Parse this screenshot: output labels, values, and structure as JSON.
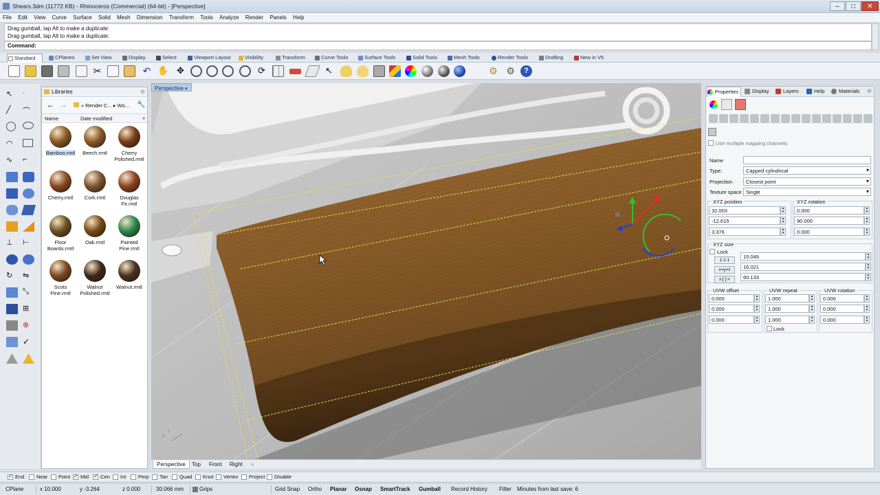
{
  "window": {
    "title": "Shears.3dm (11772 KB) - Rhinoceros (Commercial) (64-bit) - [Perspective]",
    "minimize": "–",
    "maximize": "□",
    "close": "✕"
  },
  "menu": [
    "File",
    "Edit",
    "View",
    "Curve",
    "Surface",
    "Solid",
    "Mesh",
    "Dimension",
    "Transform",
    "Tools",
    "Analyze",
    "Render",
    "Panels",
    "Help"
  ],
  "command_history": [
    "Drag gumball, tap Alt to make a duplicate:",
    "Drag gumball, tap Alt to make a duplicate:"
  ],
  "command_prompt": "Command:",
  "toolbar_tabs": [
    "Standard",
    "CPlanes",
    "Set View",
    "Display",
    "Select",
    "Viewport Layout",
    "Visibility",
    "Transform",
    "Curve Tools",
    "Surface Tools",
    "Solid Tools",
    "Mesh Tools",
    "Render Tools",
    "Drafting",
    "New in V5"
  ],
  "toolbar_icons": [
    "new-file-icon",
    "open-file-icon",
    "save-icon",
    "print-icon",
    "import-icon",
    "cut-icon",
    "copy-icon",
    "paste-icon",
    "undo-icon",
    "pan-hand-icon",
    "move-view-icon",
    "zoom-window-icon",
    "zoom-dynamic-icon",
    "zoom-extents-icon",
    "zoom-selected-icon",
    "rotate-view-icon",
    "four-viewports-icon",
    "cplane-icon",
    "viewport-icon",
    "select-icon",
    "light-bulb-icon",
    "lock-icon",
    "layer-icon",
    "color-wheel-icon",
    "render-sphere-icon",
    "shaded-sphere-icon",
    "blue-sphere-icon",
    "settings-gear-icon",
    "options-icon",
    "help-icon"
  ],
  "libraries": {
    "title": "Libraries",
    "path": "« Render C... ▸ Wo...",
    "col_name": "Name",
    "col_date": "Date modified",
    "col_more": "»",
    "materials": [
      {
        "name": "Bamboo.rmtl",
        "color": "#8a5a26",
        "selected": true
      },
      {
        "name": "Beech.rmtl",
        "color": "#8d5a2c"
      },
      {
        "name": "Cherry Polished.rmtl",
        "color": "#7a3c1c"
      },
      {
        "name": "Cherry.rmtl",
        "color": "#8a4a22"
      },
      {
        "name": "Cork.rmtl",
        "color": "#7c5630"
      },
      {
        "name": "Douglas Fir.rmtl",
        "color": "#8a4422"
      },
      {
        "name": "Floor Boards.rmtl",
        "color": "#6e5024"
      },
      {
        "name": "Oak.rmtl",
        "color": "#7a4a18"
      },
      {
        "name": "Painted Pine.rmtl",
        "color": "#2c8a4a"
      },
      {
        "name": "Scots Pine.rmtl",
        "color": "#7c4a24"
      },
      {
        "name": "Walnut Polished.rmtl",
        "color": "#3f2a1c"
      },
      {
        "name": "Walnut.rmtl",
        "color": "#4a3222"
      }
    ]
  },
  "viewport": {
    "label": "Perspective",
    "tabs": [
      "Perspective",
      "Top",
      "Front",
      "Right"
    ],
    "add_tab": "+"
  },
  "properties": {
    "tabs": [
      "Properties",
      "Display",
      "Layers",
      "Help",
      "Materials"
    ],
    "use_multiple_mapping": "Use multiple mapping channels",
    "name_label": "Name",
    "name_value": "",
    "type_label": "Type:",
    "type_value": "Capped cylindrical",
    "projection_label": "Projection",
    "projection_value": "Closest point",
    "texture_space_label": "Texture space",
    "texture_space_value": "Single",
    "xyz_position_label": "XYZ position",
    "xyz_position": [
      "32.003",
      "-12.615",
      "3.376"
    ],
    "xyz_rotation_label": "XYZ rotation",
    "xyz_rotation": [
      "0.000",
      "90.000",
      "0.000"
    ],
    "xyz_size_label": "XYZ size",
    "lock_label": "Lock",
    "size_buttons": [
      "1:1:1",
      "x=y=z",
      "x:[ ]:<"
    ],
    "xyz_size": [
      "15.049",
      "16.021",
      "60.133"
    ],
    "uvw_offset_label": "UVW offset",
    "uvw_offset": [
      "0.000",
      "0.000",
      "0.000"
    ],
    "uvw_repeat_label": "UVW repeat",
    "uvw_repeat": [
      "1.000",
      "1.000",
      "1.000"
    ],
    "uvw_repeat_lock": "Lock",
    "uvw_rotation_label": "UVW rotation",
    "uvw_rotation": [
      "0.000",
      "0.000",
      "0.000"
    ]
  },
  "osnaps": [
    {
      "label": "End",
      "checked": true
    },
    {
      "label": "Near",
      "checked": false
    },
    {
      "label": "Point",
      "checked": false
    },
    {
      "label": "Mid",
      "checked": true
    },
    {
      "label": "Cen",
      "checked": true
    },
    {
      "label": "Int",
      "checked": false
    },
    {
      "label": "Perp",
      "checked": false
    },
    {
      "label": "Tan",
      "checked": false
    },
    {
      "label": "Quad",
      "checked": false
    },
    {
      "label": "Knot",
      "checked": false
    },
    {
      "label": "Vertex",
      "checked": false
    },
    {
      "label": "Project",
      "checked": false
    },
    {
      "label": "Disable",
      "checked": false
    }
  ],
  "status": {
    "cplane": "CPlane",
    "x": "x 10.000",
    "y": "y -3.264",
    "z": "z 0.000",
    "distance": "30.066 mm",
    "layer": "Grips",
    "grid_snap": "Grid Snap",
    "ortho": "Ortho",
    "planar": "Planar",
    "osnap": "Osnap",
    "smarttrack": "SmartTrack",
    "gumball": "Gumball",
    "record_history": "Record History",
    "filter": "Filter",
    "minutes": "Minutes from last save: 6"
  },
  "colors": {
    "accent": "#b8cbe2",
    "wood": "#8a5a26",
    "gumball_red": "#e03020",
    "gumball_green": "#30c030",
    "gumball_blue": "#2040e0"
  }
}
